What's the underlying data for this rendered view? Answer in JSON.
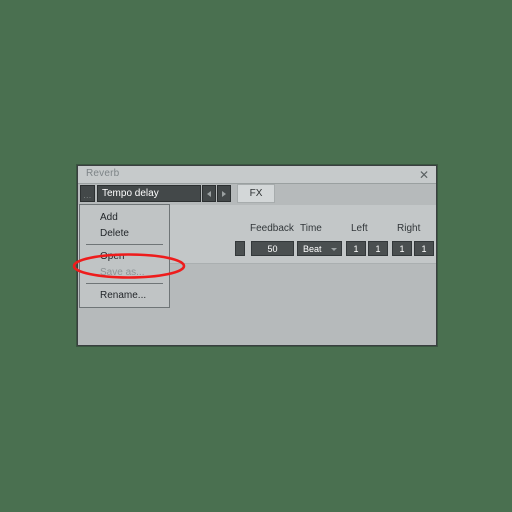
{
  "background": {
    "color": "#4a7050"
  },
  "window": {
    "title": "Reverb",
    "close_label": "✕",
    "colors": {
      "titlebar": "#c6cacb",
      "body": "#b6babb",
      "strip": "#c3c7c8",
      "field": "#4a4f50",
      "accent_annotation": "#ee1c1c"
    }
  },
  "preset_bar": {
    "menu_button_label": "...",
    "preset_name": "Tempo delay",
    "prev_label": "◀",
    "next_label": "▶",
    "fx_label": "FX"
  },
  "dropdown_menu": {
    "items": [
      {
        "label": "Add",
        "disabled": false,
        "separator_after": false
      },
      {
        "label": "Delete",
        "disabled": false,
        "separator_after": true
      },
      {
        "label": "Open",
        "disabled": false,
        "separator_after": false
      },
      {
        "label": "Save as...",
        "disabled": true,
        "separator_after": true
      },
      {
        "label": "Rename...",
        "disabled": false,
        "separator_after": false
      }
    ]
  },
  "parameters": {
    "labels": {
      "feedback": "Feedback",
      "time": "Time",
      "left": "Left",
      "right": "Right"
    },
    "values": {
      "cut": "",
      "feedback": "50",
      "time": "Beat",
      "left_1": "1",
      "left_2": "1",
      "right_1": "1",
      "right_2": "1"
    }
  },
  "annotation": {
    "shape": "red-ellipse",
    "target": "Save as...",
    "color": "#ee1c1c"
  }
}
